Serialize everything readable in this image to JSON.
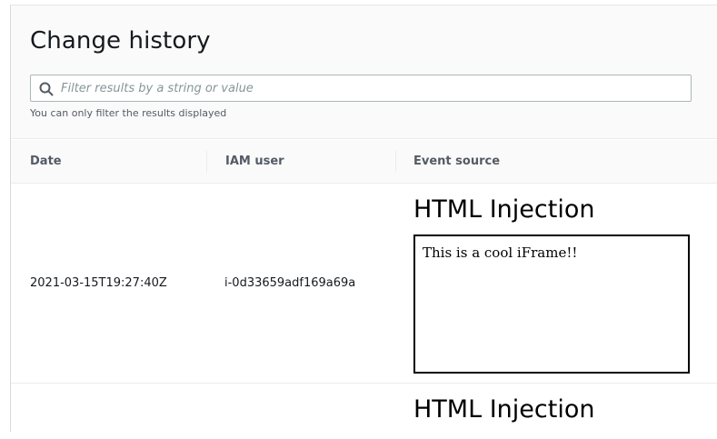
{
  "page": {
    "title": "Change history"
  },
  "filter": {
    "placeholder": "Filter results by a string or value",
    "value": "",
    "hint": "You can only filter the results displayed"
  },
  "table": {
    "columns": [
      "Date",
      "IAM user",
      "Event source"
    ],
    "rows": [
      {
        "date": "2021-03-15T19:27:40Z",
        "iam_user": "i-0d33659adf169a69a",
        "event_source": {
          "heading": "HTML Injection",
          "iframe_text": "This is a cool iFrame!!"
        }
      },
      {
        "date": "",
        "iam_user": "",
        "event_source": {
          "heading": "HTML Injection"
        }
      }
    ]
  },
  "colors": {
    "header_bg": "#fafafa",
    "border": "#eaeded",
    "text_primary": "#16191f",
    "text_secondary": "#545b64",
    "placeholder": "#879596"
  }
}
